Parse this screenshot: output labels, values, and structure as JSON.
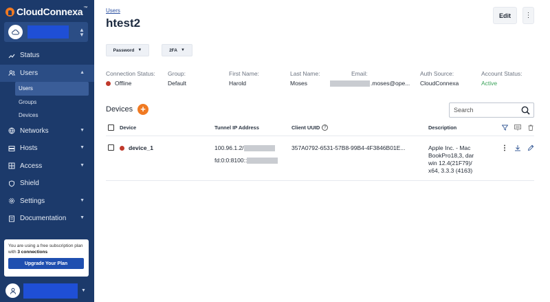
{
  "sidebar": {
    "brand": "CloudConnexa",
    "brand_mark": "™",
    "nav": [
      {
        "label": "Status",
        "icon": "chart-line-icon"
      },
      {
        "label": "Users",
        "icon": "users-icon"
      },
      {
        "label": "Networks",
        "icon": "globe-icon"
      },
      {
        "label": "Hosts",
        "icon": "server-icon"
      },
      {
        "label": "Access",
        "icon": "grid-icon"
      },
      {
        "label": "Shield",
        "icon": "shield-icon"
      },
      {
        "label": "Settings",
        "icon": "gear-icon"
      },
      {
        "label": "Documentation",
        "icon": "book-icon"
      }
    ],
    "users_subnav": [
      "Users",
      "Groups",
      "Devices"
    ],
    "plan": {
      "text_prefix": "You are using a free subscription plan with ",
      "connections": "3 connections",
      "button": "Upgrade Your Plan"
    }
  },
  "header": {
    "breadcrumb": "Users",
    "title": "htest2",
    "edit_label": "Edit",
    "more_label": "⋮"
  },
  "filters": {
    "password": "Password",
    "twofa": "2FA"
  },
  "info": {
    "connection_status_label": "Connection Status:",
    "connection_status": "Offline",
    "group_label": "Group:",
    "group": "Default",
    "first_name_label": "First Name:",
    "first_name": "Harold",
    "last_name_label": "Last Name:",
    "last_name": "Moses",
    "email_label": "Email:",
    "email_suffix": ".moses@ope...",
    "auth_source_label": "Auth Source:",
    "auth_source": "CloudConnexa",
    "account_status_label": "Account Status:",
    "account_status": "Active"
  },
  "devices": {
    "title": "Devices",
    "search_placeholder": "Search",
    "columns": {
      "device": "Device",
      "tunnel_ip": "Tunnel IP Address",
      "client_uuid": "Client UUID",
      "description": "Description"
    },
    "rows": [
      {
        "name": "device_1",
        "ipv4_prefix": "100.96.1.2/",
        "ipv6_prefix": "fd:0:0:8100::",
        "uuid": "357A0792-6531-57B8-99B4-4F3846B01E...",
        "description": "Apple Inc. - Mac BookPro18,3, dar win 12.4(21F79)/ x64, 3.3.3 (4163)"
      }
    ]
  },
  "colors": {
    "sidebar": "#1c3a6b",
    "accent": "#f07a22",
    "offline": "#c0392b",
    "active": "#3aa35a",
    "redacted_blue": "#1f4fd6"
  }
}
